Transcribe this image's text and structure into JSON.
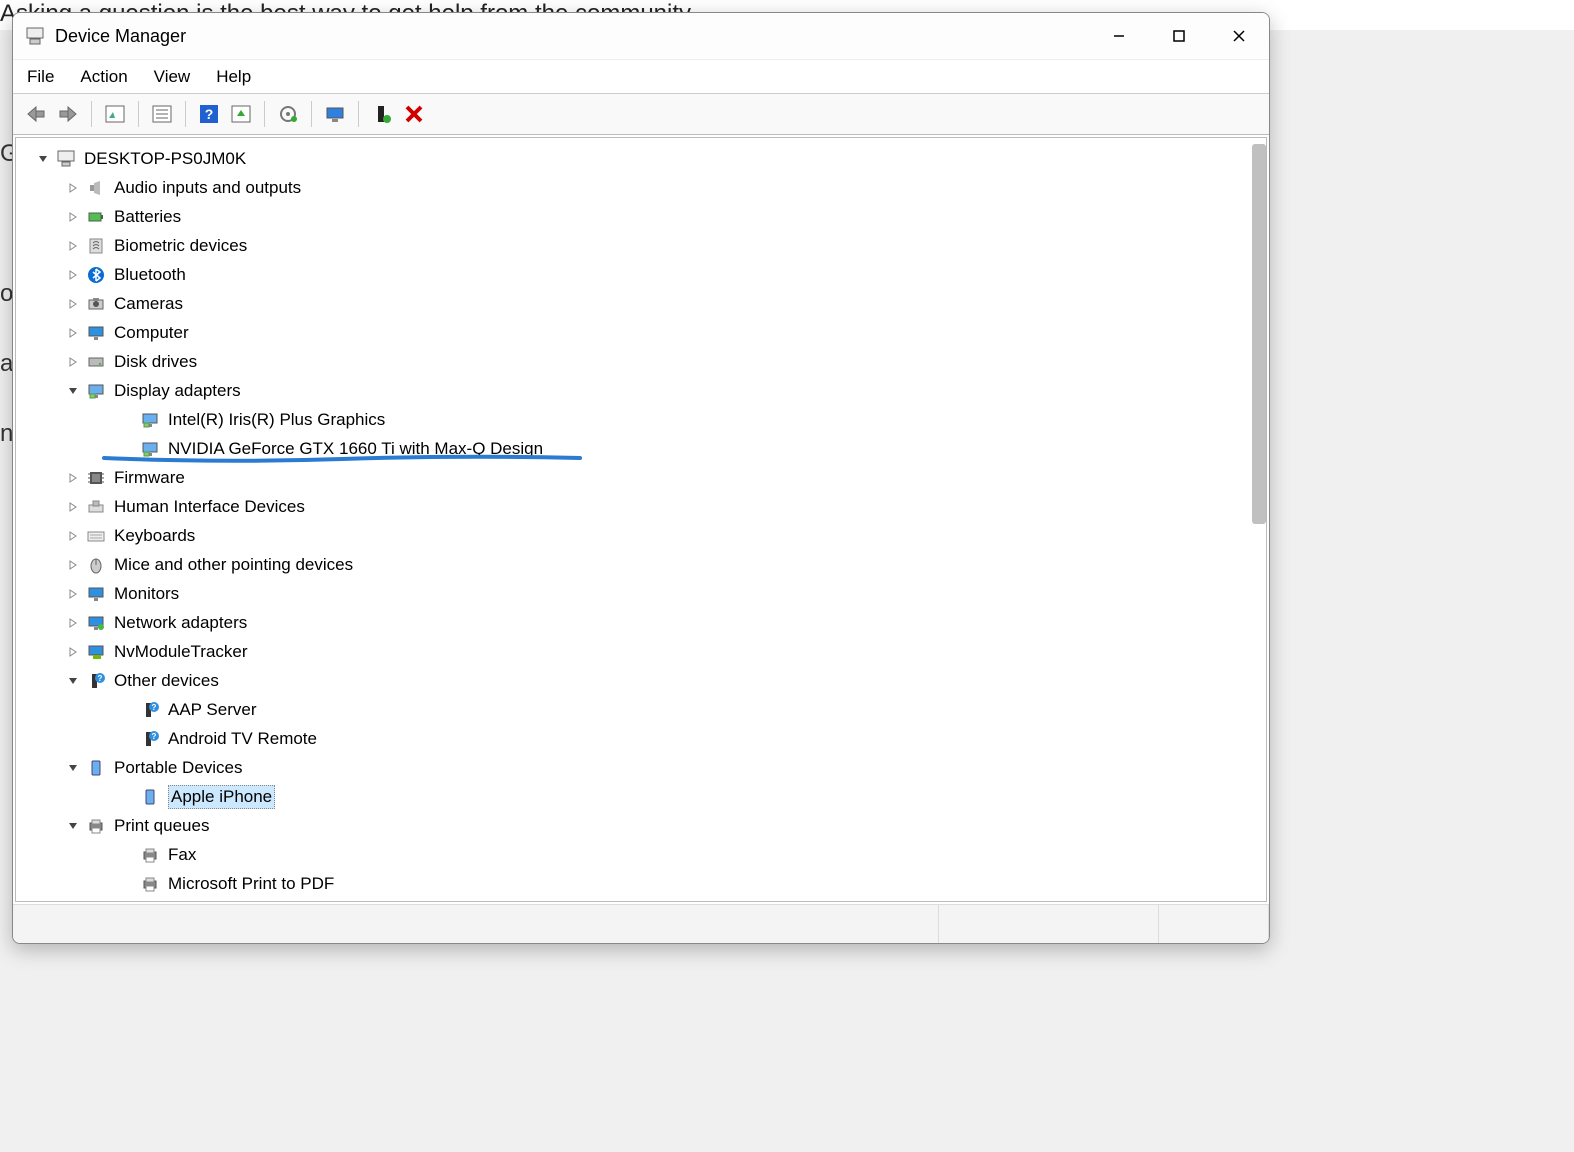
{
  "background_text": "Asking a question is the best way to get help from the community",
  "window": {
    "title": "Device Manager"
  },
  "menus": {
    "file": "File",
    "action": "Action",
    "view": "View",
    "help": "Help"
  },
  "toolbar_icons": [
    "back-icon",
    "forward-icon",
    "sep",
    "show-hidden-icon",
    "sep",
    "properties-icon",
    "sep",
    "help-icon",
    "update-driver-icon",
    "sep",
    "uninstall-icon",
    "sep",
    "scan-hardware-icon",
    "sep",
    "add-driver-icon",
    "disable-icon"
  ],
  "tree": {
    "root": {
      "label": "DESKTOP-PS0JM0K",
      "expanded": true,
      "icon": "computer-icon"
    },
    "items": [
      {
        "label": "Audio inputs and outputs",
        "icon": "speaker-icon",
        "children": []
      },
      {
        "label": "Batteries",
        "icon": "battery-icon",
        "children": []
      },
      {
        "label": "Biometric devices",
        "icon": "biometric-icon",
        "children": []
      },
      {
        "label": "Bluetooth",
        "icon": "bluetooth-icon",
        "children": []
      },
      {
        "label": "Cameras",
        "icon": "camera-icon",
        "children": []
      },
      {
        "label": "Computer",
        "icon": "monitor-icon",
        "children": []
      },
      {
        "label": "Disk drives",
        "icon": "disk-icon",
        "children": []
      },
      {
        "label": "Display adapters",
        "icon": "display-adapter-icon",
        "expanded": true,
        "children": [
          {
            "label": "Intel(R) Iris(R) Plus Graphics",
            "icon": "display-adapter-icon"
          },
          {
            "label": "NVIDIA GeForce GTX 1660 Ti with Max-Q Design",
            "icon": "display-adapter-icon",
            "underlined": true
          }
        ]
      },
      {
        "label": "Firmware",
        "icon": "firmware-icon",
        "children": []
      },
      {
        "label": "Human Interface Devices",
        "icon": "hid-icon",
        "children": []
      },
      {
        "label": "Keyboards",
        "icon": "keyboard-icon",
        "children": []
      },
      {
        "label": "Mice and other pointing devices",
        "icon": "mouse-icon",
        "children": []
      },
      {
        "label": "Monitors",
        "icon": "monitor-icon",
        "children": []
      },
      {
        "label": "Network adapters",
        "icon": "network-icon",
        "children": []
      },
      {
        "label": "NvModuleTracker",
        "icon": "nvidia-icon",
        "children": []
      },
      {
        "label": "Other devices",
        "icon": "unknown-icon",
        "expanded": true,
        "children": [
          {
            "label": "AAP Server",
            "icon": "unknown-icon"
          },
          {
            "label": "Android TV Remote",
            "icon": "unknown-icon"
          }
        ]
      },
      {
        "label": "Portable Devices",
        "icon": "portable-icon",
        "expanded": true,
        "children": [
          {
            "label": "Apple iPhone",
            "icon": "portable-icon",
            "selected": true
          }
        ]
      },
      {
        "label": "Print queues",
        "icon": "printer-icon",
        "expanded": true,
        "children": [
          {
            "label": "Fax",
            "icon": "printer-icon"
          },
          {
            "label": "Microsoft Print to PDF",
            "icon": "printer-icon"
          }
        ]
      }
    ]
  },
  "annotation_color": "#2a7bd1"
}
